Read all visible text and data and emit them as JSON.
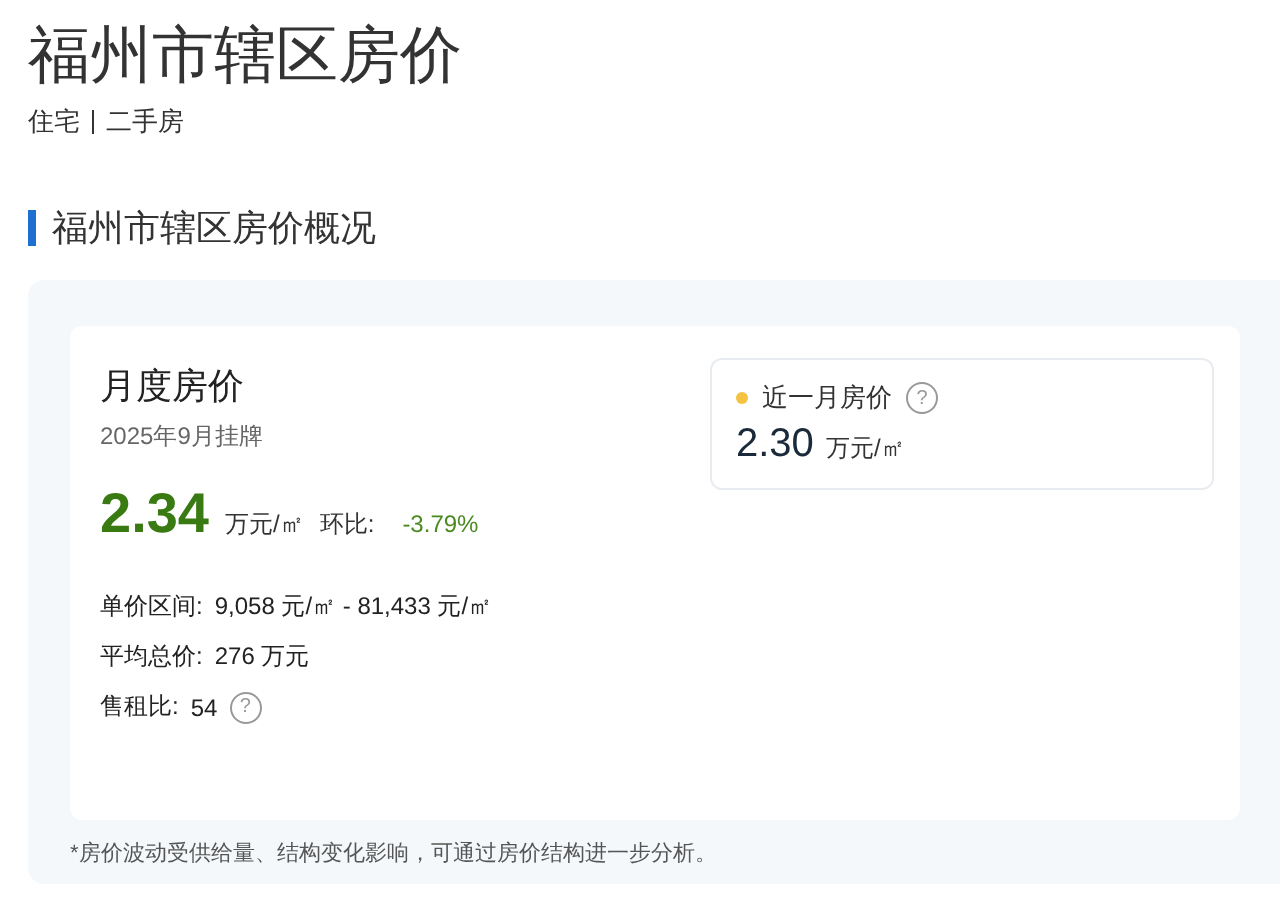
{
  "header": {
    "title": "福州市辖区房价",
    "tags": [
      "住宅",
      "二手房"
    ]
  },
  "section": {
    "title": "福州市辖区房价概况"
  },
  "monthly": {
    "title": "月度房价",
    "date": "2025年9月挂牌",
    "price": "2.34",
    "unit": "万元/㎡",
    "change_label": "环比:",
    "change": "-3.79%",
    "details": [
      {
        "label": "单价区间:",
        "value": "9,058 元/㎡ - 81,433 元/㎡"
      },
      {
        "label": "平均总价:",
        "value": "276 万元"
      },
      {
        "label": "售租比:",
        "value": "54",
        "help": "?"
      }
    ]
  },
  "recent": {
    "title": "近一月房价",
    "help": "?",
    "price": "2.30",
    "unit": "万元/㎡"
  },
  "footnote": "*房价波动受供给量、结构变化影响，可通过房价结构进一步分析。"
}
